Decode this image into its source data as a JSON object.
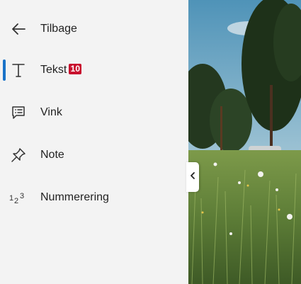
{
  "sidebar": {
    "items": [
      {
        "label": "Tilbage",
        "icon": "arrow-left-icon"
      },
      {
        "label": "Tekst",
        "icon": "text-t-icon",
        "badge": "10",
        "active": true
      },
      {
        "label": "Vink",
        "icon": "comment-list-icon"
      },
      {
        "label": "Note",
        "icon": "pin-icon"
      },
      {
        "label": "Nummerering",
        "icon": "numbering-123-icon"
      }
    ],
    "active_color": "#1a73c8",
    "badge_color": "#c8102e"
  },
  "background_photo": {
    "description_icon": "meadow-photo",
    "collapse_icon": "chevron-left-icon"
  }
}
